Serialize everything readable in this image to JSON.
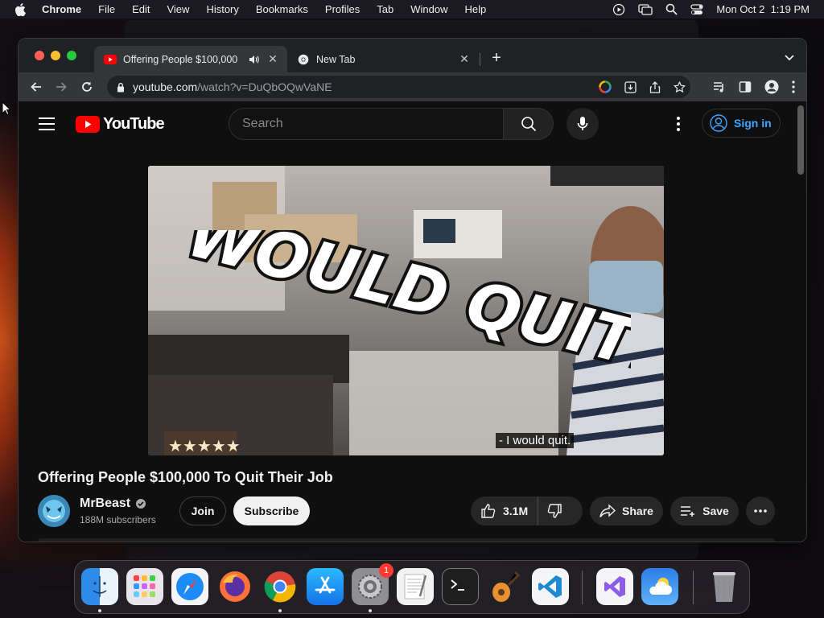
{
  "menubar": {
    "app_name": "Chrome",
    "items": [
      "File",
      "Edit",
      "View",
      "History",
      "Bookmarks",
      "Profiles",
      "Tab",
      "Window",
      "Help"
    ],
    "clock": "Mon Oct 2  1:19 PM"
  },
  "tabs": [
    {
      "title": "Offering People $100,000",
      "favicon": "youtube-icon",
      "audio": true,
      "active": true
    },
    {
      "title": "New Tab",
      "favicon": "chrome-icon",
      "active": false
    }
  ],
  "omnibox": {
    "host": "youtube.com",
    "path": "/watch?v=DuQbOQwVaNE"
  },
  "youtube": {
    "logo_text": "YouTube",
    "search_placeholder": "Search",
    "sign_in_label": "Sign in",
    "video": {
      "overlay_text": "I WOULD QUIT!",
      "caption": "- I would quit.",
      "title": "Offering People $100,000 To Quit Their Job"
    },
    "channel": {
      "name": "MrBeast",
      "subscribers": "188M subscribers",
      "verified": true
    },
    "actions": {
      "join": "Join",
      "subscribe": "Subscribe",
      "likes": "3.1M",
      "share": "Share",
      "save": "Save"
    }
  },
  "dock": {
    "apps": [
      "finder-icon",
      "launchpad-icon",
      "safari-icon",
      "firefox-icon",
      "chrome-icon",
      "app-store-icon",
      "system-settings-icon",
      "textedit-icon",
      "terminal-icon",
      "garageband-icon",
      "vscode-icon",
      "visual-studio-icon",
      "weather-icon",
      "trash-icon"
    ],
    "settings_badge": "1"
  },
  "colors": {
    "youtube_red": "#ff0000",
    "link_blue": "#3ea6ff",
    "page_bg": "#0f0f0f"
  }
}
